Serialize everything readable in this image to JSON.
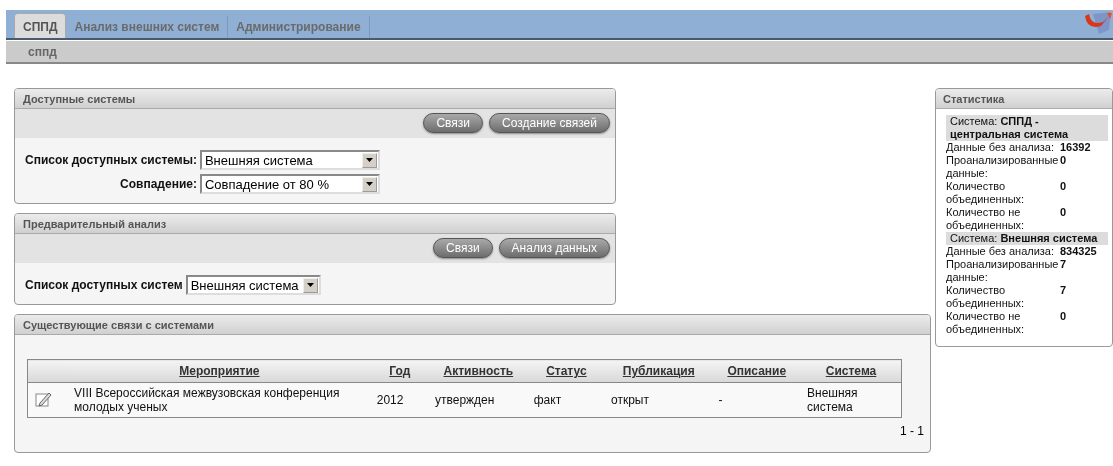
{
  "tabs": [
    {
      "label": "СППД",
      "selected": true
    },
    {
      "label": "Анализ внешних систем",
      "selected": false
    },
    {
      "label": "Администрирование",
      "selected": false
    }
  ],
  "breadcrumb": "сппд",
  "panels": [
    {
      "kind": "form",
      "title": "Доступные системы",
      "buttons": [
        "Связи",
        "Создание связей"
      ],
      "fields": [
        {
          "label": "Список доступных системы:",
          "value": "Внешняя система"
        },
        {
          "label": "Совпадение:",
          "value": "Совпадение от 80 %"
        }
      ]
    },
    {
      "kind": "form",
      "title": "Предварительный анализ",
      "buttons": [
        "Связи",
        "Анализ данных"
      ],
      "fields": [
        {
          "label": "Список доступных систем",
          "value": "Внешняя система"
        }
      ]
    },
    {
      "kind": "table",
      "title": "Существующие связи с системами",
      "columns": [
        "Мероприятие",
        "Год",
        "Активность",
        "Статус",
        "Публикация",
        "Описание",
        "Система"
      ],
      "rows": [
        {
          "cells": [
            "VIII Всероссийская межвузовская конференция молодых ученых",
            "2012",
            "утвержден",
            "факт",
            "открыт",
            "-",
            "Внешняя система"
          ]
        }
      ],
      "pagination": "1 - 1"
    }
  ],
  "statistics": {
    "title": "Статистика",
    "sections": [
      {
        "heading": "Система: **СППД - центральная система**",
        "rows": [
          {
            "label": "Данные без анализа:",
            "value": "16392"
          },
          {
            "label": "Проанализированные данные:",
            "value": "0"
          },
          {
            "label": "Количество объединенных:",
            "value": "0"
          },
          {
            "label": "Количество не объединенных:",
            "value": "0"
          }
        ]
      },
      {
        "heading": "Система: **Внешняя система**",
        "rows": [
          {
            "label": "Данные без анализа:",
            "value": "834325"
          },
          {
            "label": "Проанализированные данные:",
            "value": "7"
          },
          {
            "label": "Количество объединенных:",
            "value": "7"
          },
          {
            "label": "Количество не объединенных:",
            "value": "0"
          }
        ]
      }
    ]
  }
}
